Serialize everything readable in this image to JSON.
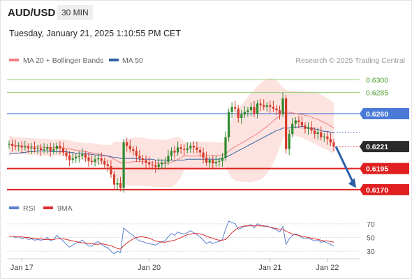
{
  "header": {
    "symbol": "AUD/USD",
    "timeframe": "30 MIN"
  },
  "timestamp": "Tuesday, January 21, 2025 1:10:55 PM CET",
  "legend": {
    "bollinger_label": "MA 20 + Bollinger Bands",
    "ma50_label": "MA 50",
    "copyright": "Research © 2025 Trading Central",
    "rsi_label": "RSI",
    "rsi_ma_label": "9MA"
  },
  "colors": {
    "resistance_green": "#8fcf73",
    "current_blue": "#4a79d6",
    "support_red": "#e02020",
    "bollinger_fill": "#fde0dc",
    "ma20": "#f08080",
    "ma50": "#3060a8",
    "candle_bull": "#2e8a2e",
    "candle_bear": "#d43a2a",
    "arrow": "#2a5fa8",
    "rsi": "#5b7fd0",
    "rsi_ma": "#d83030"
  },
  "chart_data": {
    "type": "candlestick",
    "price_levels": [
      {
        "label": "0.6300",
        "value": 0.63,
        "kind": "resistance"
      },
      {
        "label": "0.6285",
        "value": 0.6285,
        "kind": "resistance"
      },
      {
        "label": "0.6260",
        "value": 0.626,
        "kind": "pivot"
      },
      {
        "label": "0.6221",
        "value": 0.6221,
        "kind": "last"
      },
      {
        "label": "0.6195",
        "value": 0.6195,
        "kind": "support"
      },
      {
        "label": "0.6170",
        "value": 0.617,
        "kind": "support"
      }
    ],
    "price_ylim": [
      0.616,
      0.6312
    ],
    "x_ticks": [
      "Jan 17",
      "Jan 20",
      "Jan 21",
      "Jan 22"
    ],
    "x_tick_bars": [
      4,
      44,
      82,
      100
    ],
    "closes": [
      0.6224,
      0.6222,
      0.6221,
      0.6222,
      0.622,
      0.6221,
      0.6219,
      0.622,
      0.6218,
      0.6219,
      0.6217,
      0.6218,
      0.622,
      0.6216,
      0.6218,
      0.6222,
      0.6219,
      0.6214,
      0.621,
      0.6205,
      0.6207,
      0.6209,
      0.621,
      0.6212,
      0.6208,
      0.6204,
      0.6203,
      0.6206,
      0.6207,
      0.6204,
      0.62,
      0.6198,
      0.6188,
      0.6176,
      0.6178,
      0.6172,
      0.6226,
      0.6222,
      0.6218,
      0.6216,
      0.621,
      0.6207,
      0.6205,
      0.6202,
      0.62,
      0.6199,
      0.6197,
      0.62,
      0.6202,
      0.6203,
      0.621,
      0.6216,
      0.6214,
      0.622,
      0.6218,
      0.6217,
      0.6219,
      0.6222,
      0.622,
      0.6217,
      0.6214,
      0.6208,
      0.6202,
      0.6205,
      0.6201,
      0.6203,
      0.6204,
      0.6208,
      0.6232,
      0.6262,
      0.6268,
      0.6266,
      0.6255,
      0.6259,
      0.6262,
      0.6264,
      0.6268,
      0.626,
      0.6272,
      0.627,
      0.6268,
      0.627,
      0.6268,
      0.6266,
      0.6264,
      0.626,
      0.6278,
      0.6218,
      0.6236,
      0.6248,
      0.6252,
      0.625,
      0.6246,
      0.6242,
      0.6244,
      0.624,
      0.6236,
      0.6238,
      0.6232,
      0.6233,
      0.623,
      0.6226,
      0.6221
    ],
    "ma50": [
      0.6212,
      0.6213,
      0.6213,
      0.6213,
      0.6214,
      0.6214,
      0.6215,
      0.6215,
      0.6215,
      0.6216,
      0.6216,
      0.6216,
      0.6216,
      0.6215,
      0.6215,
      0.6215,
      0.6215,
      0.6215,
      0.6215,
      0.6214,
      0.6214,
      0.6213,
      0.6213,
      0.6213,
      0.6213,
      0.6212,
      0.6212,
      0.6211,
      0.6211,
      0.6211,
      0.621,
      0.621,
      0.6209,
      0.6208,
      0.6208,
      0.6207,
      0.6207,
      0.6207,
      0.6207,
      0.6207,
      0.6207,
      0.6206,
      0.6206,
      0.6206,
      0.6206,
      0.6206,
      0.6205,
      0.6205,
      0.6205,
      0.6205,
      0.6205,
      0.6205,
      0.6205,
      0.6205,
      0.6205,
      0.6205,
      0.6206,
      0.6206,
      0.6206,
      0.6206,
      0.6206,
      0.6206,
      0.6206,
      0.6206,
      0.6206,
      0.6206,
      0.6206,
      0.6207,
      0.6208,
      0.621,
      0.6212,
      0.6214,
      0.6216,
      0.6218,
      0.622,
      0.6222,
      0.6224,
      0.6226,
      0.6228,
      0.623,
      0.6232,
      0.6234,
      0.6236,
      0.6238,
      0.624,
      0.6241,
      0.6243,
      0.6243,
      0.6243,
      0.6244,
      0.6244,
      0.6244,
      0.6245,
      0.6244,
      0.6243,
      0.6242,
      0.6242,
      0.6241,
      0.624,
      0.6239,
      0.6239,
      0.6238,
      0.6237
    ],
    "ma50_projection": [
      0.6238,
      0.6238
    ],
    "forecast_arrow": {
      "from": 0.6221,
      "to": 0.6172,
      "bars_ahead": 7
    },
    "rsi": {
      "ticks": [
        70,
        50,
        30
      ],
      "ylim": [
        25,
        78
      ],
      "values": [
        52,
        52,
        50,
        51,
        48,
        50,
        47,
        48,
        46,
        47,
        46,
        47,
        50,
        45,
        47,
        53,
        49,
        45,
        40,
        36,
        39,
        42,
        43,
        46,
        41,
        38,
        37,
        42,
        44,
        40,
        37,
        35,
        30,
        26,
        30,
        28,
        64,
        60,
        56,
        53,
        48,
        45,
        44,
        42,
        41,
        40,
        39,
        42,
        44,
        45,
        51,
        56,
        53,
        58,
        56,
        55,
        57,
        60,
        57,
        54,
        51,
        46,
        41,
        44,
        41,
        43,
        44,
        47,
        62,
        74,
        72,
        70,
        62,
        64,
        66,
        67,
        69,
        64,
        70,
        68,
        66,
        67,
        65,
        63,
        61,
        58,
        66,
        40,
        48,
        53,
        55,
        53,
        50,
        48,
        49,
        47,
        45,
        46,
        43,
        44,
        42,
        40,
        37
      ],
      "ma9": [
        52,
        52,
        51,
        51,
        51,
        50,
        50,
        49,
        49,
        48,
        48,
        47,
        47,
        47,
        47,
        48,
        48,
        48,
        47,
        46,
        45,
        44,
        43,
        42,
        42,
        41,
        41,
        40,
        40,
        41,
        40,
        39,
        38,
        36,
        34,
        33,
        38,
        42,
        45,
        48,
        50,
        51,
        51,
        50,
        49,
        47,
        45,
        44,
        43,
        43,
        44,
        45,
        46,
        48,
        50,
        52,
        54,
        55,
        56,
        56,
        55,
        54,
        52,
        50,
        49,
        47,
        46,
        46,
        47,
        52,
        57,
        61,
        64,
        66,
        67,
        67,
        67,
        67,
        67,
        67,
        67,
        66,
        65,
        64,
        63,
        62,
        62,
        59,
        57,
        55,
        54,
        53,
        52,
        51,
        50,
        49,
        48,
        47,
        46,
        45,
        45,
        44,
        43
      ]
    }
  }
}
